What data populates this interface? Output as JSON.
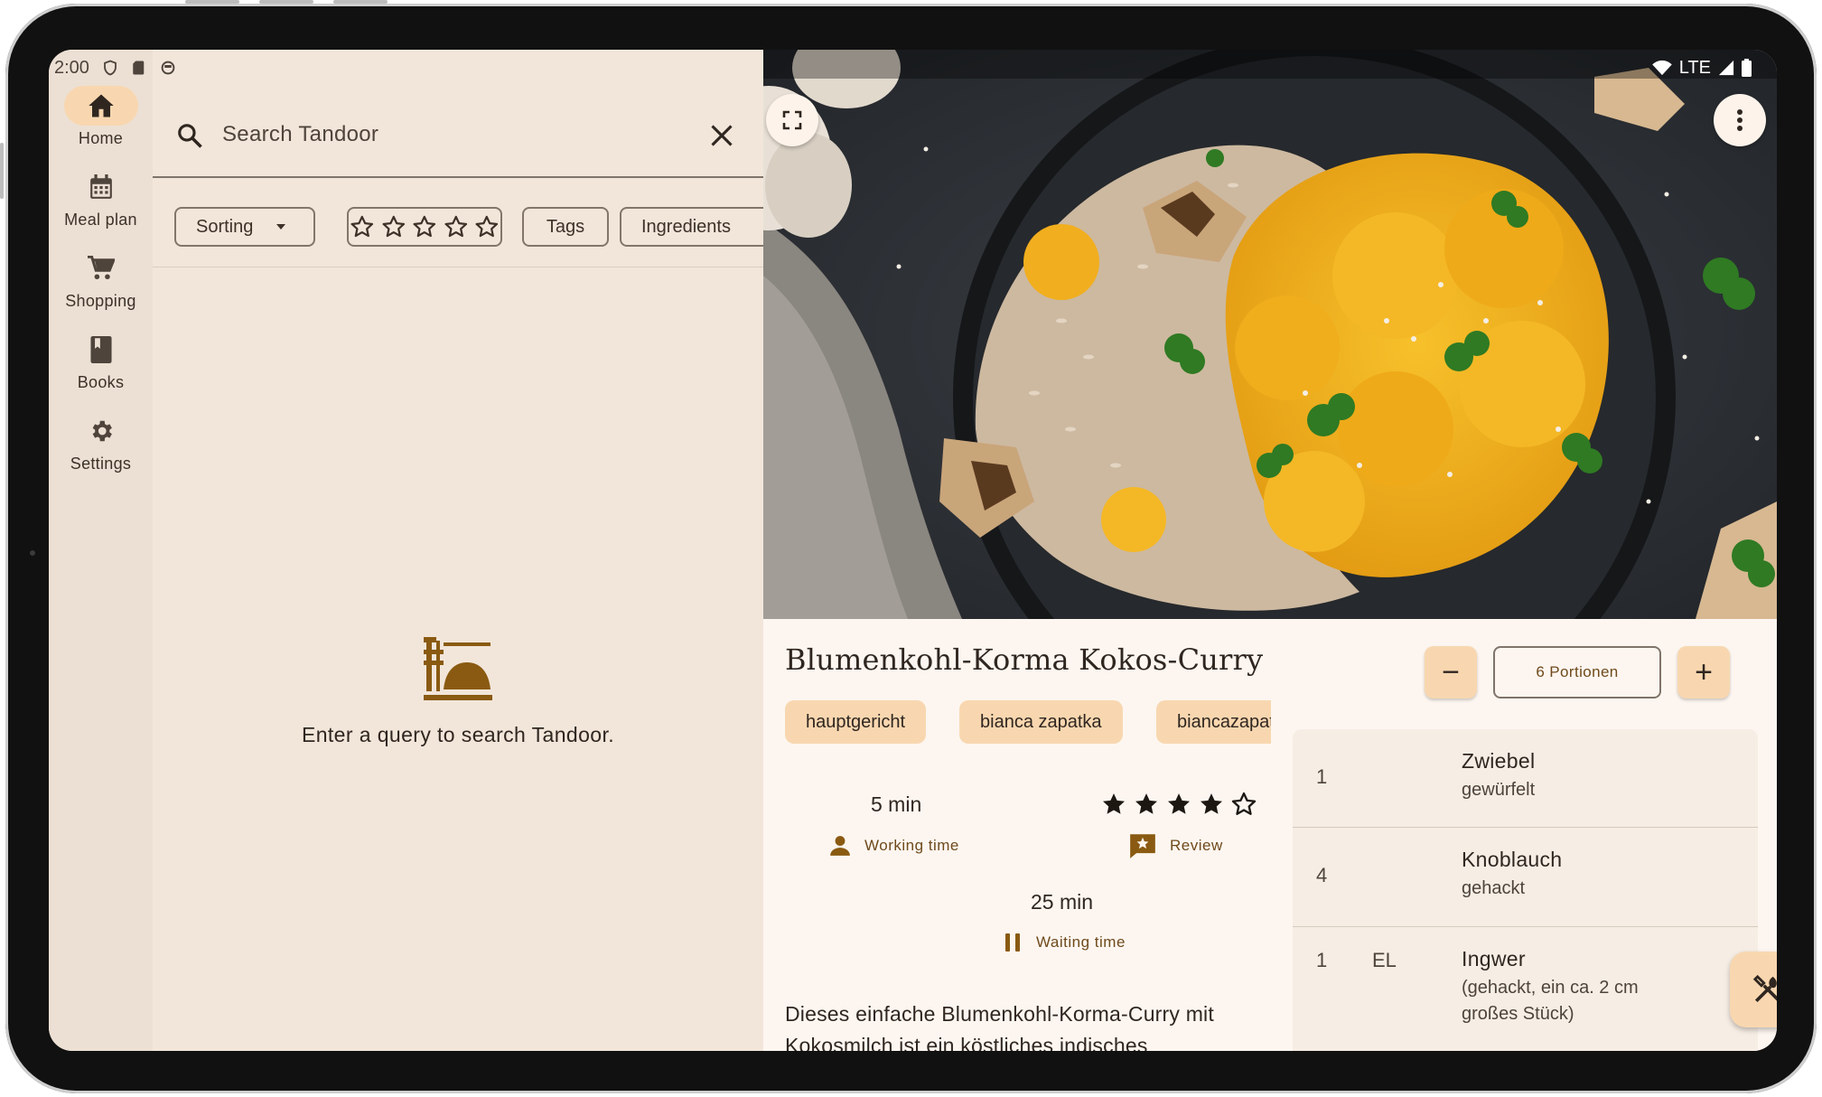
{
  "status_bar": {
    "time": "2:00",
    "network": "LTE"
  },
  "nav_rail": {
    "items": [
      {
        "label": "Home",
        "icon": "home-icon",
        "active": true
      },
      {
        "label": "Meal plan",
        "icon": "calendar-icon",
        "active": false
      },
      {
        "label": "Shopping",
        "icon": "cart-icon",
        "active": false
      },
      {
        "label": "Books",
        "icon": "book-icon",
        "active": false
      },
      {
        "label": "Settings",
        "icon": "gear-icon",
        "active": false
      }
    ]
  },
  "search": {
    "placeholder": "Search Tandoor",
    "filters": {
      "sorting": "Sorting",
      "rating_stars": 5,
      "tags": "Tags",
      "ingredients": "Ingredients"
    },
    "empty_message": "Enter a query to search Tandoor."
  },
  "recipe": {
    "title": "Blumenkohl-Korma Kokos-Curry",
    "tags": [
      "hauptgericht",
      "bianca zapatka",
      "biancazapatka"
    ],
    "working_time": {
      "value": "5 min",
      "label": "Working time"
    },
    "rating": {
      "filled": 4,
      "max": 5,
      "label": "Review"
    },
    "waiting_time": {
      "value": "25 min",
      "label": "Waiting time"
    },
    "description": "Dieses einfache Blumenkohl-Korma-Curry mit Kokosmilch ist ein köstliches indisches",
    "servings": {
      "label": "6 Portionen",
      "decrease": "−",
      "increase": "+"
    },
    "ingredients": [
      {
        "amount": "1",
        "unit": "",
        "name": "Zwiebel",
        "note": "gewürfelt"
      },
      {
        "amount": "4",
        "unit": "",
        "name": "Knoblauch",
        "note": "gehackt"
      },
      {
        "amount": "1",
        "unit": "EL",
        "name": "Ingwer",
        "note": "(gehackt, ein ca. 2 cm großes Stück)"
      }
    ]
  },
  "colors": {
    "accent": "#8a5a12",
    "container": "#f8d7b0",
    "surface": "#f2e6da",
    "detail_surface": "#fdf6f0"
  }
}
